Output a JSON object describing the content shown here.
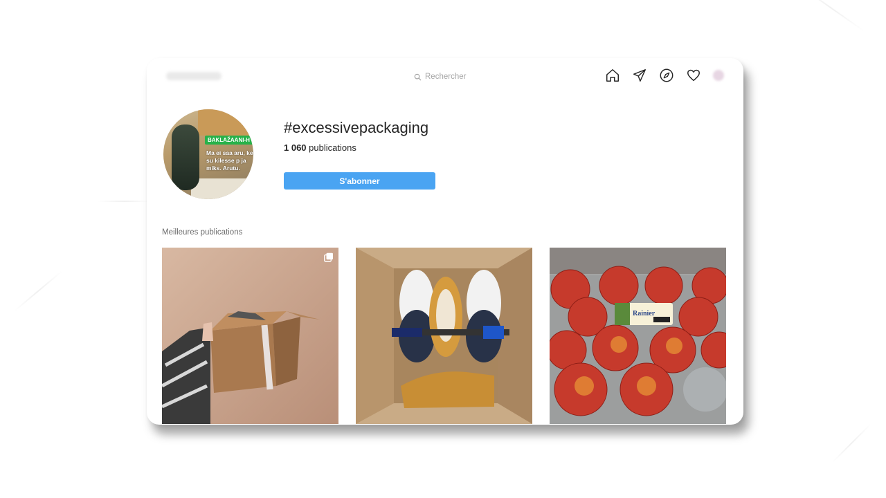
{
  "header": {
    "account_name": "",
    "search_placeholder": "Rechercher",
    "nav_icons": [
      "home-icon",
      "direct-send-icon",
      "explore-compass-icon",
      "activity-heart-icon",
      "profile-avatar"
    ]
  },
  "hashtag": {
    "title": "#excessivepackaging",
    "count_number": "1 060",
    "count_label": "publications",
    "follow_label": "S'abonner",
    "profile_tag": "BAKLAŽAANI-H",
    "profile_caption": "Ma ei saa aru, kes su kilesse p ja miks. Arutu."
  },
  "top_posts": {
    "label": "Meilleures publications",
    "posts": [
      {
        "subject": "hand holding cardboard box with tape",
        "multi": true
      },
      {
        "subject": "shoes and screwdriver in cardboard box",
        "multi": false
      },
      {
        "subject": "apples in plastic clamshell",
        "multi": false,
        "label_text": "Rainier"
      }
    ]
  },
  "colors": {
    "follow_button": "#4aa4f2",
    "text_primary": "#262626",
    "text_secondary": "#6c6c6c"
  }
}
